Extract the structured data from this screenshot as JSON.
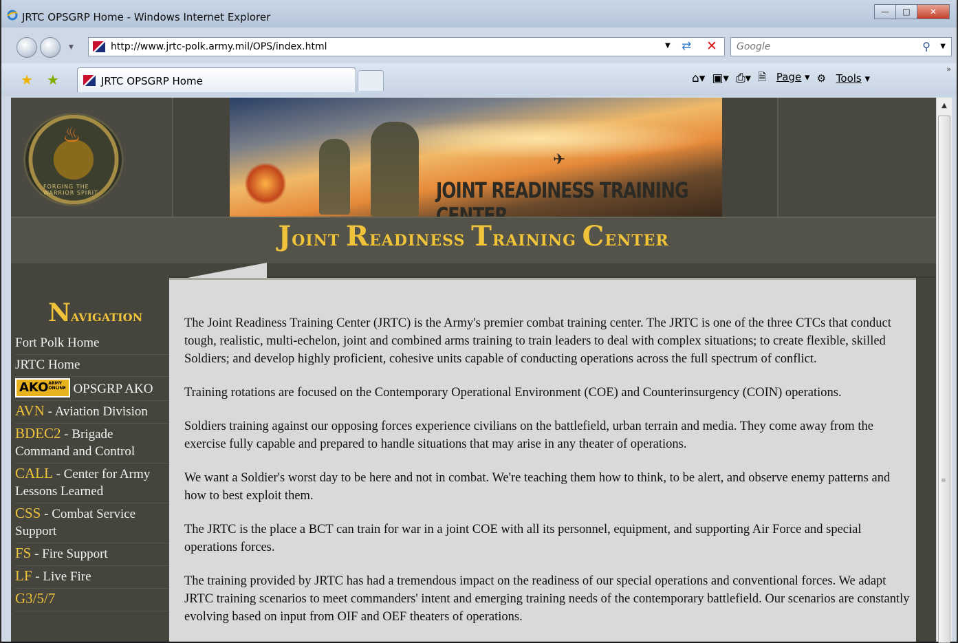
{
  "browser": {
    "window_title": "JRTC OPSGRP Home - Windows Internet Explorer",
    "address_url": "http://www.jrtc-polk.army.mil/OPS/index.html",
    "search_placeholder": "Google",
    "tab_label": "JRTC OPSGRP Home",
    "commands": {
      "page": "Page",
      "tools": "Tools"
    }
  },
  "header": {
    "banner_text": "JOINT READINESS TRAINING CENTER",
    "seal_text": "FORGING THE WARRIOR SPIRIT",
    "title_words": [
      {
        "cap": "J",
        "rest": "OINT"
      },
      {
        "cap": "R",
        "rest": "EADINESS"
      },
      {
        "cap": "T",
        "rest": "RAINING"
      },
      {
        "cap": "C",
        "rest": "ENTER"
      }
    ]
  },
  "navigation": {
    "heading_cap": "N",
    "heading_rest": "AVIGATION",
    "items": [
      {
        "abbr": "",
        "label": "Fort Polk Home"
      },
      {
        "abbr": "",
        "label": "JRTC Home"
      },
      {
        "abbr": "",
        "label": "OPSGRP AKO",
        "badge": "AKO"
      },
      {
        "abbr": "AVN",
        "label": " - Aviation Division"
      },
      {
        "abbr": "BDEC2",
        "label": " - Brigade Command and Control"
      },
      {
        "abbr": "CALL",
        "label": " - Center for Army Lessons Learned"
      },
      {
        "abbr": "CSS",
        "label": " - Combat Service Support"
      },
      {
        "abbr": "FS",
        "label": " - Fire Support"
      },
      {
        "abbr": "LF",
        "label": " - Live Fire"
      },
      {
        "abbr": "G3/5/7",
        "label": ""
      }
    ]
  },
  "content": {
    "paragraphs": [
      "The Joint Readiness Training Center (JRTC) is the Army's premier combat training center. The JRTC is one of the three CTCs that conduct tough, realistic, multi-echelon, joint and combined arms training to train leaders to deal with complex situations; to create flexible, skilled Soldiers; and develop highly proficient, cohesive units capable of conducting operations across the full spectrum of conflict.",
      "Training rotations are focused on the Contemporary Operational Environment (COE) and Counterinsurgency (COIN) operations.",
      "Soldiers training against our opposing forces experience civilians on the battlefield, urban terrain and media. They come away from the exercise fully capable and prepared to handle situations that may arise in any theater of operations.",
      "We want a Soldier's worst day to be here and not in combat. We're teaching them how to think, to be alert, and observe enemy patterns and how to best exploit them.",
      "The JRTC is the place a BCT can train for war in a joint COE with all its personnel, equipment, and supporting Air Force and special operations forces.",
      "The training provided by JRTC has had a tremendous impact on the readiness of our special operations and conventional forces. We adapt JRTC training scenarios to meet commanders' intent and emerging training needs of the contemporary battlefield. Our scenarios are constantly evolving based on input from OIF and OEF theaters of operations."
    ]
  },
  "colors": {
    "accent_gold": "#f0c33a",
    "panel_dark": "#45453d",
    "content_bg": "#d9d9d9"
  }
}
